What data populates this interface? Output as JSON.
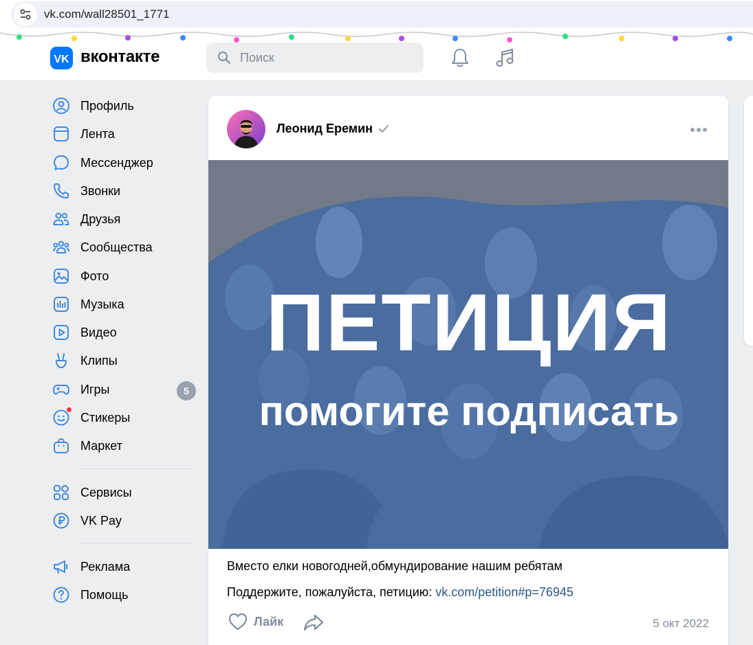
{
  "browser": {
    "url": "vk.com/wall28501_1771"
  },
  "header": {
    "logo_text": "вконтакте",
    "search_placeholder": "Поиск"
  },
  "sidebar": {
    "items": [
      {
        "label": "Профиль",
        "icon": "profile-icon"
      },
      {
        "label": "Лента",
        "icon": "feed-icon"
      },
      {
        "label": "Мессенджер",
        "icon": "messenger-icon"
      },
      {
        "label": "Звонки",
        "icon": "phone-icon"
      },
      {
        "label": "Друзья",
        "icon": "friends-icon"
      },
      {
        "label": "Сообщества",
        "icon": "communities-icon"
      },
      {
        "label": "Фото",
        "icon": "photo-icon"
      },
      {
        "label": "Музыка",
        "icon": "music-icon"
      },
      {
        "label": "Видео",
        "icon": "video-icon"
      },
      {
        "label": "Клипы",
        "icon": "clips-icon"
      },
      {
        "label": "Игры",
        "icon": "games-icon",
        "badge": "5"
      },
      {
        "label": "Стикеры",
        "icon": "stickers-icon"
      },
      {
        "label": "Маркет",
        "icon": "market-icon"
      },
      {
        "label": "Сервисы",
        "icon": "services-icon"
      },
      {
        "label": "VK Pay",
        "icon": "vkpay-icon"
      },
      {
        "label": "Реклама",
        "icon": "ads-icon"
      },
      {
        "label": "Помощь",
        "icon": "help-icon"
      }
    ]
  },
  "post": {
    "author": "Леонид Еремин",
    "image_title": "ПЕТИЦИЯ",
    "image_subtitle": "помогите подписать",
    "text_line1": "Вместо елки новогодней,обмундирование нашим ребятам",
    "text_line2_prefix": "Поддержите, пожалуйста, петицию: ",
    "text_link": "vk.com/petition#p=76945",
    "like_label": "Лайк",
    "date": "5 окт 2022"
  },
  "colors": {
    "accent": "#0077ff",
    "link": "#2a5885",
    "muted": "#818c99",
    "page_bg": "#edeef0"
  }
}
